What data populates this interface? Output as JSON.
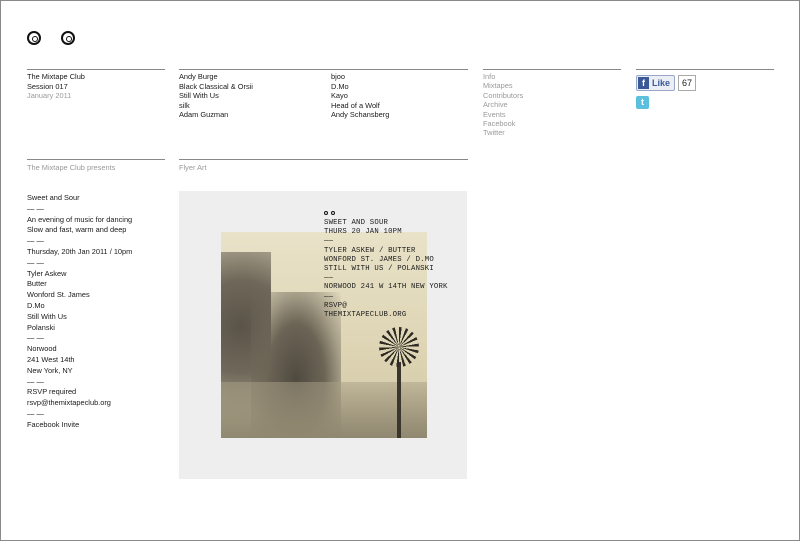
{
  "header": {
    "logo_label": "OO",
    "club": "The Mixtape Club",
    "session": "Session 017",
    "date": "January 2011"
  },
  "artists_col1": [
    "Andy Burge",
    "Black Classical & Orsii",
    "Still With Us",
    "silk",
    "Adam Guzman"
  ],
  "artists_col2": [
    "bjoo",
    "D.Mo",
    "Kayo",
    "Head of a Wolf",
    "Andy Schansberg"
  ],
  "nav": [
    "Info",
    "Mixtapes",
    "Contributors",
    "Archive",
    "Events",
    "Facebook",
    "Twitter"
  ],
  "social": {
    "like_label": "Like",
    "like_count": "67",
    "fb_icon": "f",
    "twitter_icon": "t"
  },
  "presents_heading": "The Mixtape Club presents",
  "flyer_heading": "Flyer Art",
  "event_lines": [
    "Sweet and Sour",
    "— —",
    "An evening of music for dancing",
    "Slow and fast, warm and deep",
    "— —",
    "Thursday, 20th Jan 2011 / 10pm",
    "— —",
    "Tyler Askew",
    "Butter",
    "Wonford St. James",
    "D.Mo",
    "Still With Us",
    "Polanski",
    "— —",
    "Norwood",
    "241 West 14th",
    "New York, NY",
    "— —",
    "RSVP required",
    "rsvp@themixtapeclub.org",
    "— —",
    "Facebook Invite"
  ],
  "flyer_text": [
    "SWEET AND SOUR",
    "THURS 20 JAN 10PM",
    "——",
    "TYLER ASKEW / BUTTER",
    "WONFORD ST. JAMES / D.MO",
    "STILL WITH US / POLANSKI",
    "——",
    "NORWOOD 241 W 14TH NEW YORK",
    "——",
    "RSVP@",
    "THEMIXTAPECLUB.ORG"
  ],
  "flyer_image": "windmill-photo"
}
